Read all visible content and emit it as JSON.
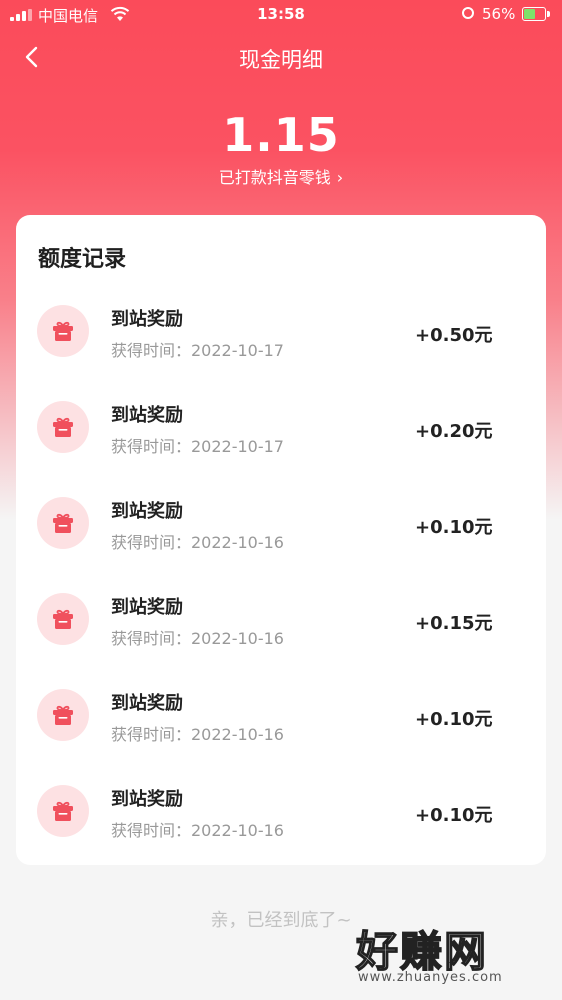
{
  "status_bar": {
    "carrier": "中国电信",
    "time": "13:58",
    "battery_percent": "56%",
    "battery_level": 0.56
  },
  "nav": {
    "title": "现金明细",
    "back_icon": "chevron-left-icon"
  },
  "summary": {
    "amount": "1.15",
    "payout_label": "已打款抖音零钱",
    "payout_chevron": "›"
  },
  "card": {
    "title": "额度记录",
    "records": [
      {
        "name": "到站奖励",
        "time": "获得时间：2022-10-17",
        "amount": "+0.50元"
      },
      {
        "name": "到站奖励",
        "time": "获得时间：2022-10-17",
        "amount": "+0.20元"
      },
      {
        "name": "到站奖励",
        "time": "获得时间：2022-10-16",
        "amount": "+0.10元"
      },
      {
        "name": "到站奖励",
        "time": "获得时间：2022-10-16",
        "amount": "+0.15元"
      },
      {
        "name": "到站奖励",
        "time": "获得时间：2022-10-16",
        "amount": "+0.10元"
      },
      {
        "name": "到站奖励",
        "time": "获得时间：2022-10-16",
        "amount": "+0.10元"
      }
    ]
  },
  "footer": {
    "end_note": "亲，已经到底了~",
    "watermark_text": "好赚网",
    "watermark_url": "www.zhuanyes.com"
  },
  "colors": {
    "brand_red": "#fb4b5a",
    "icon_bg": "#fde1e3",
    "icon_fg": "#f0505d"
  }
}
